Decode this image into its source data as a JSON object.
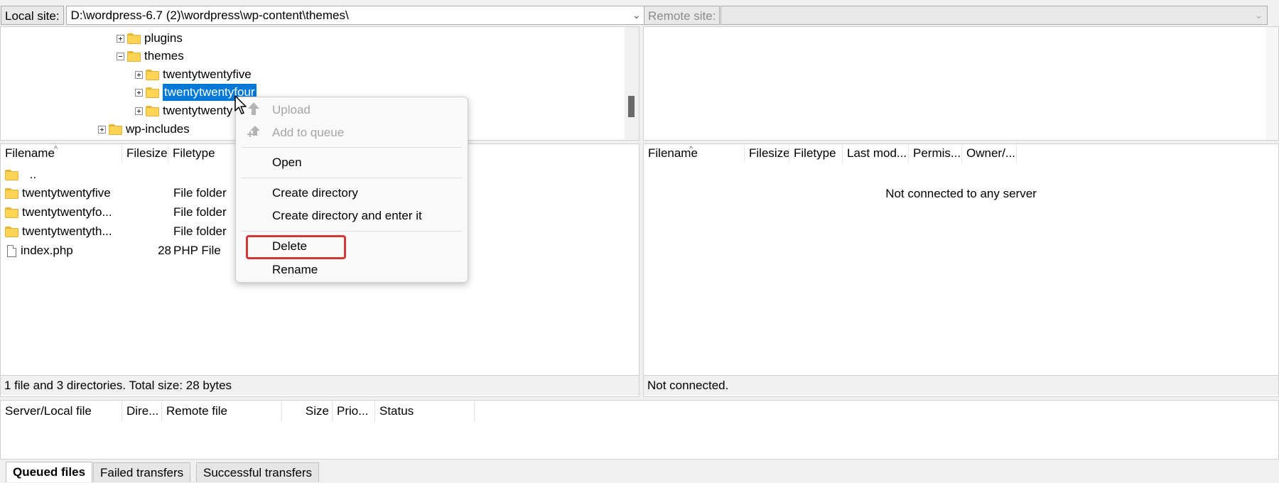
{
  "local": {
    "site_label": "Local site:",
    "path": "D:\\wordpress-6.7 (2)\\wordpress\\wp-content\\themes\\",
    "tree": [
      {
        "label": "plugins",
        "expander": "plus"
      },
      {
        "label": "themes",
        "expander": "minus"
      },
      {
        "label": "twentytwentyfive",
        "expander": "plus"
      },
      {
        "label": "twentytwentyfour",
        "expander": "plus"
      },
      {
        "label": "twentytwenty",
        "expander": "plus"
      },
      {
        "label": "wp-includes",
        "expander": "plus"
      }
    ],
    "columns": {
      "filename": "Filename",
      "filesize": "Filesize",
      "filetype": "Filetype"
    },
    "files": [
      {
        "name": "..",
        "size": "",
        "type": ""
      },
      {
        "name": "twentytwentyfive",
        "size": "",
        "type": "File folder"
      },
      {
        "name": "twentytwentyfo...",
        "size": "",
        "type": "File folder"
      },
      {
        "name": "twentytwentyth...",
        "size": "",
        "type": "File folder"
      },
      {
        "name": "index.php",
        "size": "28",
        "type": "PHP File"
      }
    ],
    "status": "1 file and 3 directories. Total size: 28 bytes"
  },
  "remote": {
    "site_label": "Remote site:",
    "columns": {
      "filename": "Filename",
      "filesize": "Filesize",
      "filetype": "Filetype",
      "last_modified": "Last mod...",
      "permissions": "Permis...",
      "owner": "Owner/..."
    },
    "empty_message": "Not connected to any server",
    "status": "Not connected."
  },
  "context_menu": {
    "upload": "Upload",
    "add_to_queue": "Add to queue",
    "open": "Open",
    "create_directory": "Create directory",
    "create_directory_enter": "Create directory and enter it",
    "delete": "Delete",
    "rename": "Rename"
  },
  "queue": {
    "columns": {
      "server_local": "Server/Local file",
      "direction": "Dire...",
      "remote_file": "Remote file",
      "size": "Size",
      "priority": "Prio...",
      "status": "Status"
    }
  },
  "tabs": [
    "Queued files",
    "Failed transfers",
    "Successful transfers"
  ],
  "colors": {
    "selection": "#0078d7",
    "highlight_box": "#d33838",
    "folder": "#ffd454"
  }
}
